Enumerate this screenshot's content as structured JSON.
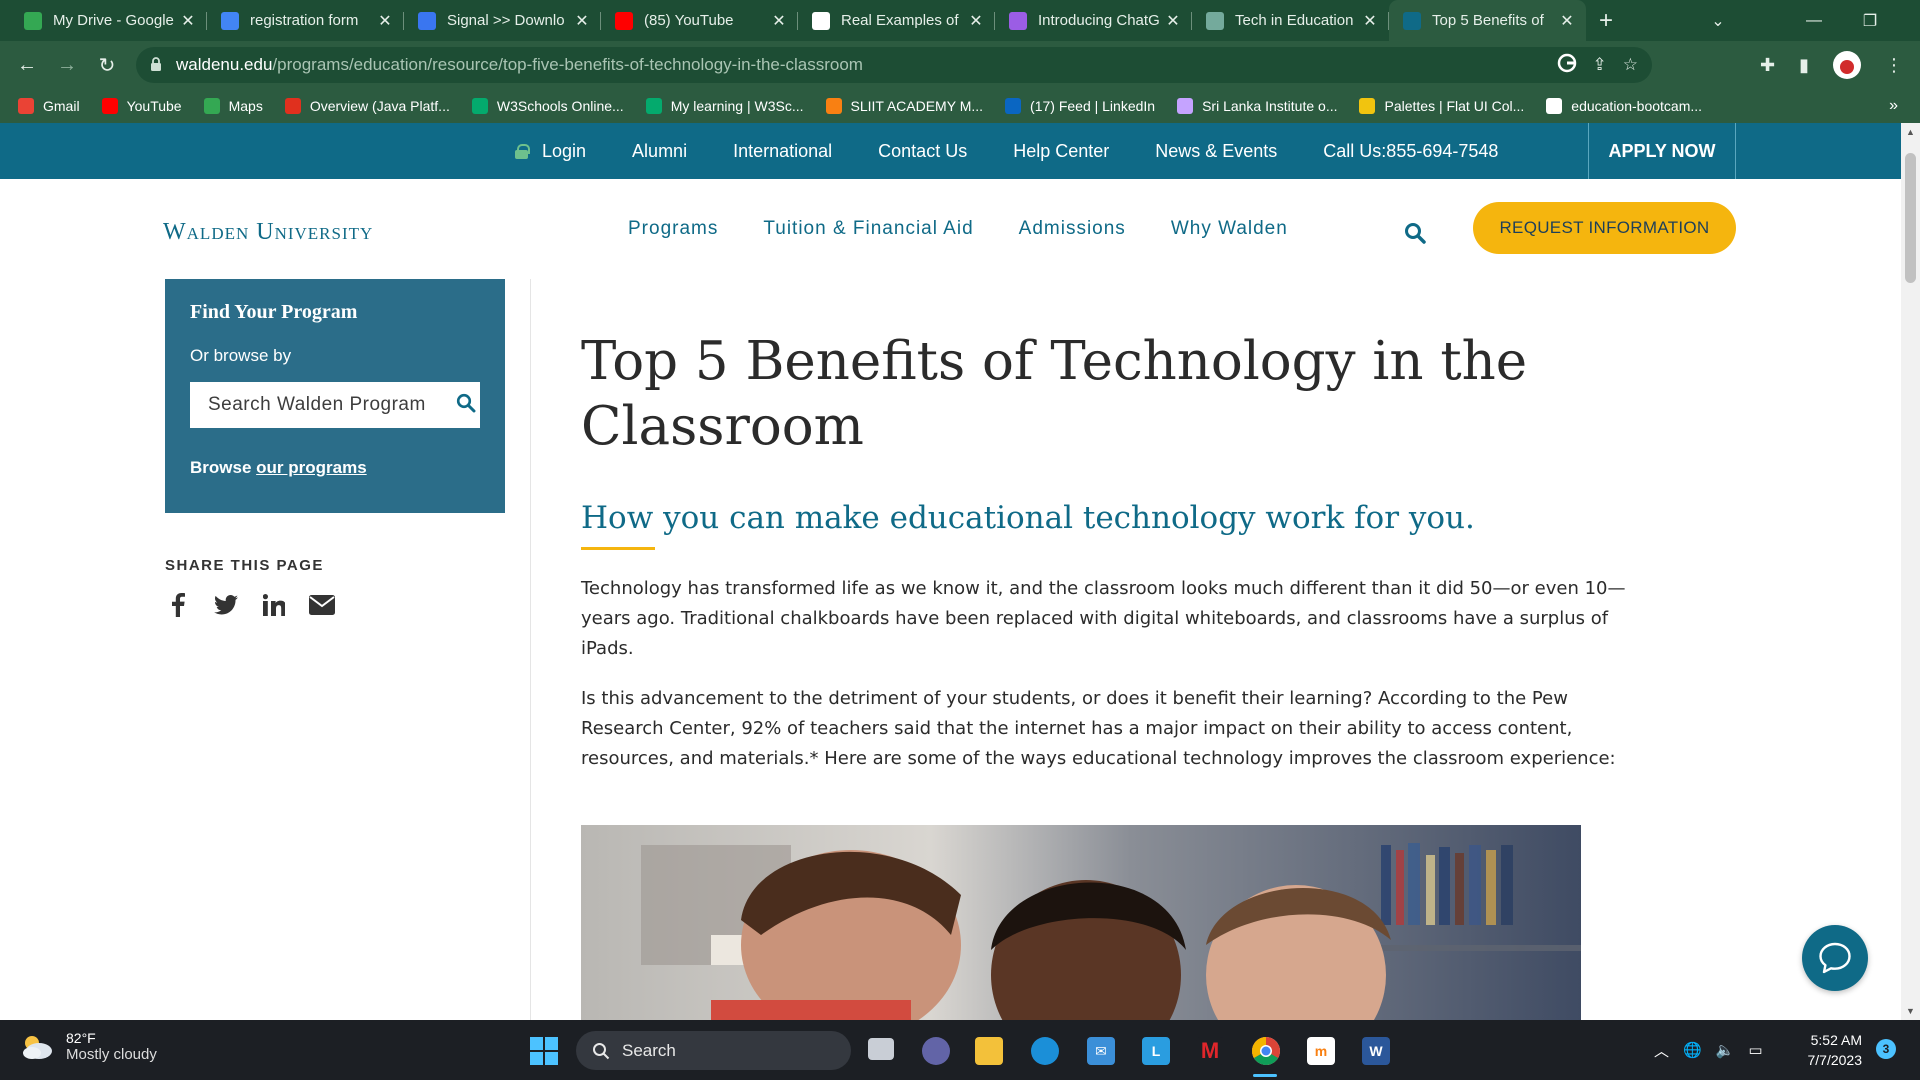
{
  "browser": {
    "tabs": [
      {
        "title": "My Drive - Google",
        "icon": "google-drive-icon",
        "color": "#34a853"
      },
      {
        "title": "registration form",
        "icon": "google-docs-icon",
        "color": "#4285f4"
      },
      {
        "title": "Signal >> Downlo",
        "icon": "signal-icon",
        "color": "#3a76f0"
      },
      {
        "title": "(85) YouTube",
        "icon": "youtube-icon",
        "color": "#ff0000"
      },
      {
        "title": "Real Examples of",
        "icon": "google-icon",
        "color": "#ffffff"
      },
      {
        "title": "Introducing ChatG",
        "icon": "openai-icon",
        "color": "#9b5de5"
      },
      {
        "title": "Tech in Education",
        "icon": "chatgpt-icon",
        "color": "#74aa9c"
      },
      {
        "title": "Top 5 Benefits of",
        "icon": "walden-icon",
        "color": "#0f6a87",
        "active": true
      }
    ],
    "url_host": "waldenu.edu",
    "url_path": "/programs/education/resource/top-five-benefits-of-technology-in-the-classroom",
    "bookmarks": [
      {
        "label": "Gmail",
        "icon": "gmail-icon",
        "color": "#ea4335"
      },
      {
        "label": "YouTube",
        "icon": "youtube-icon",
        "color": "#ff0000"
      },
      {
        "label": "Maps",
        "icon": "maps-icon",
        "color": "#34a853"
      },
      {
        "label": "Overview (Java Platf...",
        "icon": "oracle-icon",
        "color": "#e0301e"
      },
      {
        "label": "W3Schools Online...",
        "icon": "w3schools-icon",
        "color": "#04aa6d"
      },
      {
        "label": "My learning | W3Sc...",
        "icon": "w3schools-icon",
        "color": "#04aa6d"
      },
      {
        "label": "SLIIT ACADEMY M...",
        "icon": "moodle-icon",
        "color": "#f98012"
      },
      {
        "label": "(17) Feed | LinkedIn",
        "icon": "linkedin-icon",
        "color": "#0a66c2"
      },
      {
        "label": "Sri Lanka Institute o...",
        "icon": "sliit-icon",
        "color": "#c5a3ff"
      },
      {
        "label": "Palettes | Flat UI Col...",
        "icon": "flatui-icon",
        "color": "#f1c40f"
      },
      {
        "label": "education-bootcam...",
        "icon": "github-icon",
        "color": "#ffffff"
      }
    ],
    "bookmarks_more": "»"
  },
  "site": {
    "util_links": {
      "login": "Login",
      "alumni": "Alumni",
      "international": "International",
      "contact": "Contact Us",
      "help": "Help Center",
      "news": "News & Events",
      "call": "Call Us:855-694-7548"
    },
    "apply": "APPLY NOW",
    "logo": "Walden University",
    "nav": {
      "programs": "Programs",
      "tuition": "Tuition & Financial Aid",
      "admissions": "Admissions",
      "why": "Why Walden"
    },
    "request": "REQUEST INFORMATION",
    "colors": {
      "primary": "#0f6a87",
      "accent": "#f5b50e",
      "sidebar": "#2b6d89"
    }
  },
  "sidebar": {
    "find_title": "Find Your Program",
    "browse_by": "Or browse by",
    "search_placeholder": "Search Walden Program",
    "browse_prefix": "Browse ",
    "browse_link": "our programs",
    "share_title": "SHARE THIS PAGE",
    "share_icons": [
      "facebook-icon",
      "twitter-icon",
      "linkedin-icon",
      "email-icon"
    ]
  },
  "article": {
    "title": "Top 5 Benefits of Technology in the Classroom",
    "subtitle": "How you can make educational technology work for you.",
    "paragraphs": [
      "Technology has transformed life as we know it, and the classroom looks much different than it did 50—or even 10—years ago. Traditional chalkboards have been replaced with digital whiteboards, and classrooms have a surplus of iPads.",
      "Is this advancement to the detriment of your students, or does it benefit their learning? According to the Pew Research Center, 92% of teachers said that the internet has a major impact on their ability to access content, resources, and materials.* Here are some of the ways educational technology improves the classroom experience:"
    ]
  },
  "taskbar": {
    "temp": "82°F",
    "condition": "Mostly cloudy",
    "search": "Search",
    "time": "5:52 AM",
    "date": "7/7/2023",
    "notifications": "3"
  }
}
